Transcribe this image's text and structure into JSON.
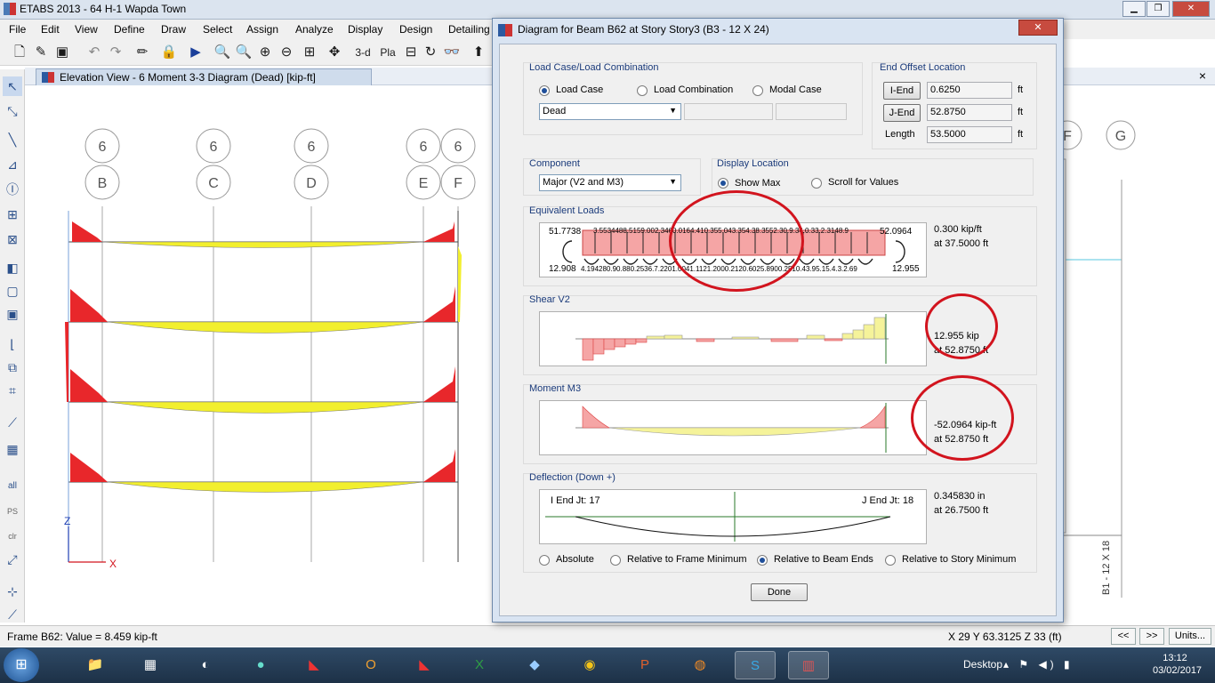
{
  "window": {
    "title": "ETABS 2013  -  64 H-1 Wapda Town"
  },
  "menu": [
    "File",
    "Edit",
    "View",
    "Define",
    "Draw",
    "Select",
    "Assign",
    "Analyze",
    "Display",
    "Design",
    "Detailing"
  ],
  "toolbar": {
    "view_3d_label": "3-d",
    "plan_label": "Pla"
  },
  "left_tools": {
    "all_label": "all",
    "ps_label": "PS",
    "clr_label": "clr"
  },
  "doc_tab": {
    "title": "Elevation View - 6    Moment 3-3 Diagram    (Dead)  [kip-ft]",
    "close": "×"
  },
  "elevation": {
    "grid_numbers": [
      "6",
      "6",
      "6",
      "6",
      "6"
    ],
    "grid_letters": [
      "B",
      "C",
      "D",
      "E",
      "F"
    ],
    "right_grid_letters": [
      "F",
      "G"
    ],
    "axis_z": "Z",
    "axis_x": "X",
    "side_label": "B1 - 12 X 18"
  },
  "dialog": {
    "title": "Diagram for Beam B62 at Story Story3 (B3 - 12 X 24)",
    "close": "✕",
    "load_case_group": {
      "title": "Load Case/Load Combination",
      "options": [
        "Load Case",
        "Load Combination",
        "Modal Case"
      ],
      "selected": "Load Case",
      "case_value": "Dead"
    },
    "end_offset": {
      "title": "End Offset Location",
      "i_end_label": "I-End",
      "i_end_value": "0.6250",
      "j_end_label": "J-End",
      "j_end_value": "52.8750",
      "length_label": "Length",
      "length_value": "53.5000",
      "unit": "ft"
    },
    "component": {
      "title": "Component",
      "value": "Major (V2 and M3)"
    },
    "display_location": {
      "title": "Display Location",
      "options": [
        "Show Max",
        "Scroll for Values"
      ],
      "selected": "Show Max"
    },
    "equivalent_loads": {
      "title": "Equivalent Loads",
      "left_top": "51.7738",
      "right_top": "52.0964",
      "left_bottom": "12.908",
      "right_bottom": "12.955",
      "top_row": "3.5534488.5159.002.3460.0164.410.355.043.354.38.3552.30.9.34.0.33.2.3148.9",
      "bottom_row": "4.194280.90.880.2536.7.2201.0041.1121.2000.2120.6025.8900.2510.43.95.15.4.3.2.69",
      "value_line1": "0.300 kip/ft",
      "value_line2": "at 37.5000 ft"
    },
    "shear": {
      "title": "Shear V2",
      "value_line1": "12.955 kip",
      "value_line2": "at 52.8750 ft"
    },
    "moment": {
      "title": "Moment M3",
      "value_line1": "-52.0964 kip-ft",
      "value_line2": "at 52.8750 ft"
    },
    "deflection": {
      "title": "Deflection (Down +)",
      "i_end": "I End Jt: 17",
      "j_end": "J End Jt: 18",
      "value_line1": "0.345830 in",
      "value_line2": "at 26.7500 ft",
      "options": [
        "Absolute",
        "Relative to Frame Minimum",
        "Relative to Beam Ends",
        "Relative to Story Minimum"
      ],
      "selected": "Relative to Beam Ends"
    },
    "done_label": "Done"
  },
  "status": {
    "left": "Frame B62:  Value = 8.459 kip-ft",
    "coords": "X 29  Y 63.3125  Z 33 (ft)",
    "prev": "<<",
    "next": ">>",
    "units": "Units..."
  },
  "taskbar": {
    "desktop": "Desktop",
    "time": "13:12",
    "date": "03/02/2017"
  },
  "colors": {
    "moment_fill": "#e8272b",
    "deflected_fill": "#f2ef2e",
    "shear_fill": "#f5a5a5",
    "shear_pos_fill": "#f5f39a",
    "annotation": "#d2141e",
    "axis_blue": "#1f3fb4"
  }
}
